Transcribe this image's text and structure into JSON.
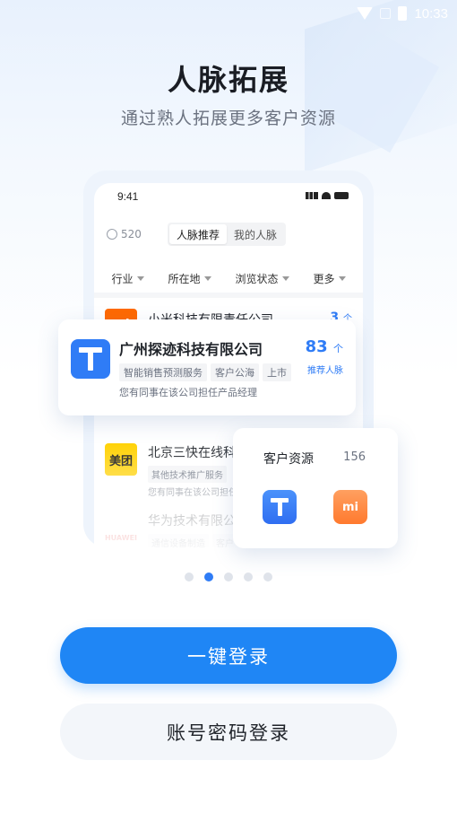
{
  "status_bar": {
    "time": "10:33"
  },
  "header": {
    "title": "人脉拓展",
    "subtitle": "通过熟人拓展更多客户资源"
  },
  "mockup": {
    "time": "9:41",
    "coins": "520",
    "tabs": [
      "人脉推荐",
      "我的人脉"
    ],
    "active_tab": 0,
    "filters": [
      "行业",
      "所在地",
      "浏览状态",
      "更多"
    ],
    "companies": [
      {
        "name": "小米科技有限责任公司",
        "count": "3",
        "unit": "个",
        "logo_text": "mi",
        "logo_color": "#ff6900"
      },
      {
        "name": "北京三快在线科",
        "tags": [
          "其他技术推广服务"
        ],
        "note": "您有同事在该公司担任",
        "logo_text": "美团",
        "logo_color": "#ffd100"
      },
      {
        "name": "华为技术有限公",
        "tags": [
          "通信设备制造",
          "客户"
        ],
        "logo_text": "HUAWEI",
        "logo_color": "#e0201d"
      }
    ]
  },
  "card_featured": {
    "name": "广州探迹科技有限公司",
    "tags": [
      "智能销售预测服务",
      "客户公海",
      "上市"
    ],
    "note": "您有同事在该公司担任产品经理",
    "count": "83",
    "unit": "个",
    "count_label": "推荐人脉",
    "logo_color": "#2f7cf6"
  },
  "card_resources": {
    "title": "客户资源",
    "count": "156"
  },
  "pager": {
    "total": 5,
    "active": 1
  },
  "actions": {
    "primary": "一键登录",
    "secondary": "账号密码登录"
  }
}
